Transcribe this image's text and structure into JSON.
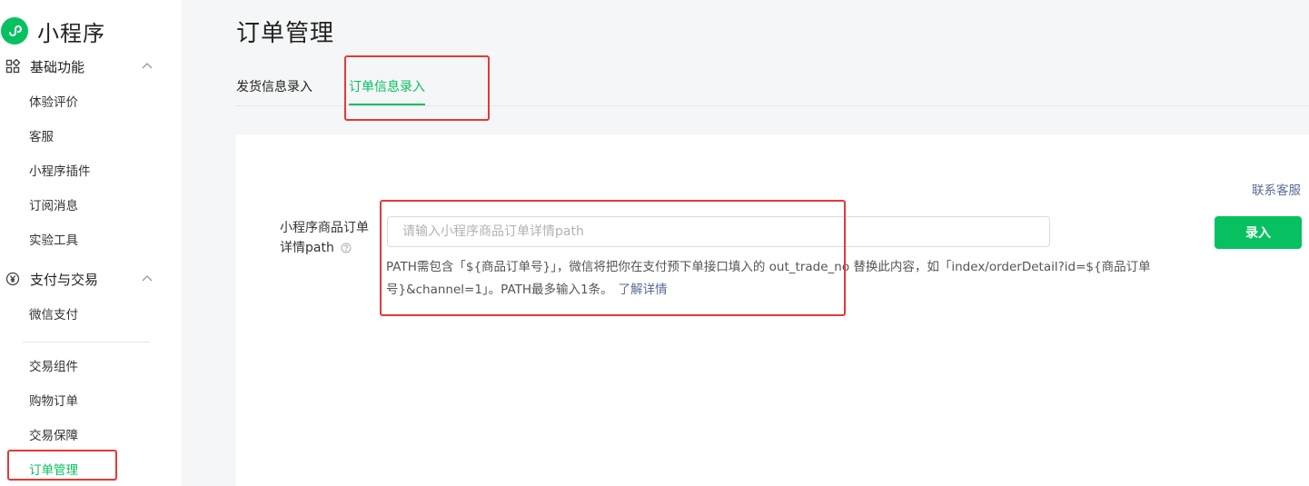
{
  "brand": {
    "title": "小程序",
    "logo_icon": "mini-program-logo-icon",
    "color": "#07c160"
  },
  "sidebar": {
    "groups": [
      {
        "label": "基础功能",
        "icon": "grid-icon",
        "items": [
          "体验评价",
          "客服",
          "小程序插件",
          "订阅消息",
          "实验工具"
        ]
      },
      {
        "label": "支付与交易",
        "icon": "yen-icon",
        "items": [
          "微信支付",
          "交易组件",
          "购物订单",
          "交易保障",
          "订单管理"
        ]
      }
    ],
    "active_item": "订单管理"
  },
  "page": {
    "title": "订单管理"
  },
  "tabs": [
    {
      "label": "发货信息录入",
      "active": false
    },
    {
      "label": "订单信息录入",
      "active": true
    }
  ],
  "form": {
    "contact_link": "联系客服",
    "label": "小程序商品订单详情path",
    "placeholder": "请输入小程序商品订单详情path",
    "value": "",
    "submit_label": "录入",
    "description": "PATH需包含「${商品订单号}」，微信将把你在支付预下单接口填入的 out_trade_no 替换此内容，如「index/orderDetail?id=${商品订单号}&channel=1」。PATH最多输入1条。",
    "learn_more": "了解详情"
  },
  "colors": {
    "accent": "#07c160",
    "link": "#576b95",
    "annotation": "#e53935"
  }
}
